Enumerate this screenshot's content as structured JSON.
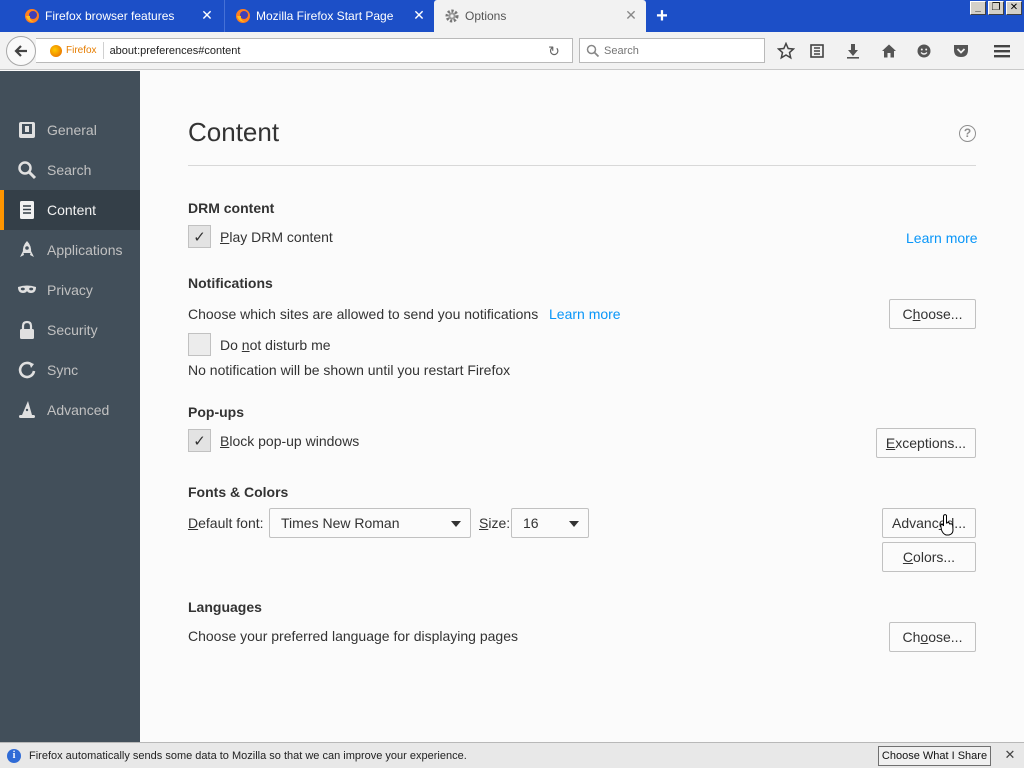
{
  "tabs": [
    {
      "label": "Firefox browser features",
      "favicon": "firefox-icon",
      "active": false
    },
    {
      "label": "Mozilla Firefox Start Page",
      "favicon": "firefox-icon",
      "active": false
    },
    {
      "label": "Options",
      "favicon": "gear-icon",
      "active": true
    }
  ],
  "navbar": {
    "identity_label": "Firefox",
    "url": "about:preferences#content",
    "search_placeholder": "Search"
  },
  "sidebar": {
    "items": [
      {
        "label": "General",
        "icon": "general-icon",
        "selected": false
      },
      {
        "label": "Search",
        "icon": "search-icon",
        "selected": false
      },
      {
        "label": "Content",
        "icon": "content-icon",
        "selected": true
      },
      {
        "label": "Applications",
        "icon": "applications-icon",
        "selected": false
      },
      {
        "label": "Privacy",
        "icon": "privacy-mask-icon",
        "selected": false
      },
      {
        "label": "Security",
        "icon": "lock-icon",
        "selected": false
      },
      {
        "label": "Sync",
        "icon": "sync-icon",
        "selected": false
      },
      {
        "label": "Advanced",
        "icon": "wizard-hat-icon",
        "selected": false
      }
    ]
  },
  "main": {
    "title": "Content",
    "drm": {
      "heading": "DRM content",
      "checkbox_label_u": "P",
      "checkbox_label_rest": "lay DRM content",
      "checked": true,
      "learn_more": "Learn more"
    },
    "notifications": {
      "heading": "Notifications",
      "description": "Choose which sites are allowed to send you notifications",
      "learn_more": "Learn more",
      "choose_u": "h",
      "choose_pre": "C",
      "choose_rest": "oose...",
      "dnd_u": "n",
      "dnd_pre": "Do ",
      "dnd_rest": "ot disturb me",
      "dnd_checked": false,
      "dnd_note": "No notification will be shown until you restart Firefox"
    },
    "popups": {
      "heading": "Pop-ups",
      "checkbox_u": "B",
      "checkbox_rest": "lock pop-up windows",
      "checked": true,
      "exceptions_u": "E",
      "exceptions_rest": "xceptions..."
    },
    "fonts": {
      "heading": "Fonts & Colors",
      "default_font_u": "D",
      "default_font_rest": "efault font:",
      "font_value": "Times New Roman",
      "size_u": "S",
      "size_rest": "ize:",
      "size_value": "16",
      "advanced_pre": "Advanc",
      "advanced_u": "e",
      "advanced_rest": "d...",
      "colors_u": "C",
      "colors_rest": "olors..."
    },
    "languages": {
      "heading": "Languages",
      "description": "Choose your preferred language for displaying pages",
      "choose_pre": "Ch",
      "choose_u": "o",
      "choose_rest": "ose..."
    }
  },
  "notification_bar": {
    "text": "Firefox automatically sends some data to Mozilla so that we can improve your experience.",
    "button_label": "Choose What I Share"
  },
  "colors": {
    "tabstrip": "#1c4fc7",
    "sidebar": "#424f5a",
    "sidebar_selected": "#343f48",
    "accent": "#ff9500",
    "link": "#0996f8"
  }
}
